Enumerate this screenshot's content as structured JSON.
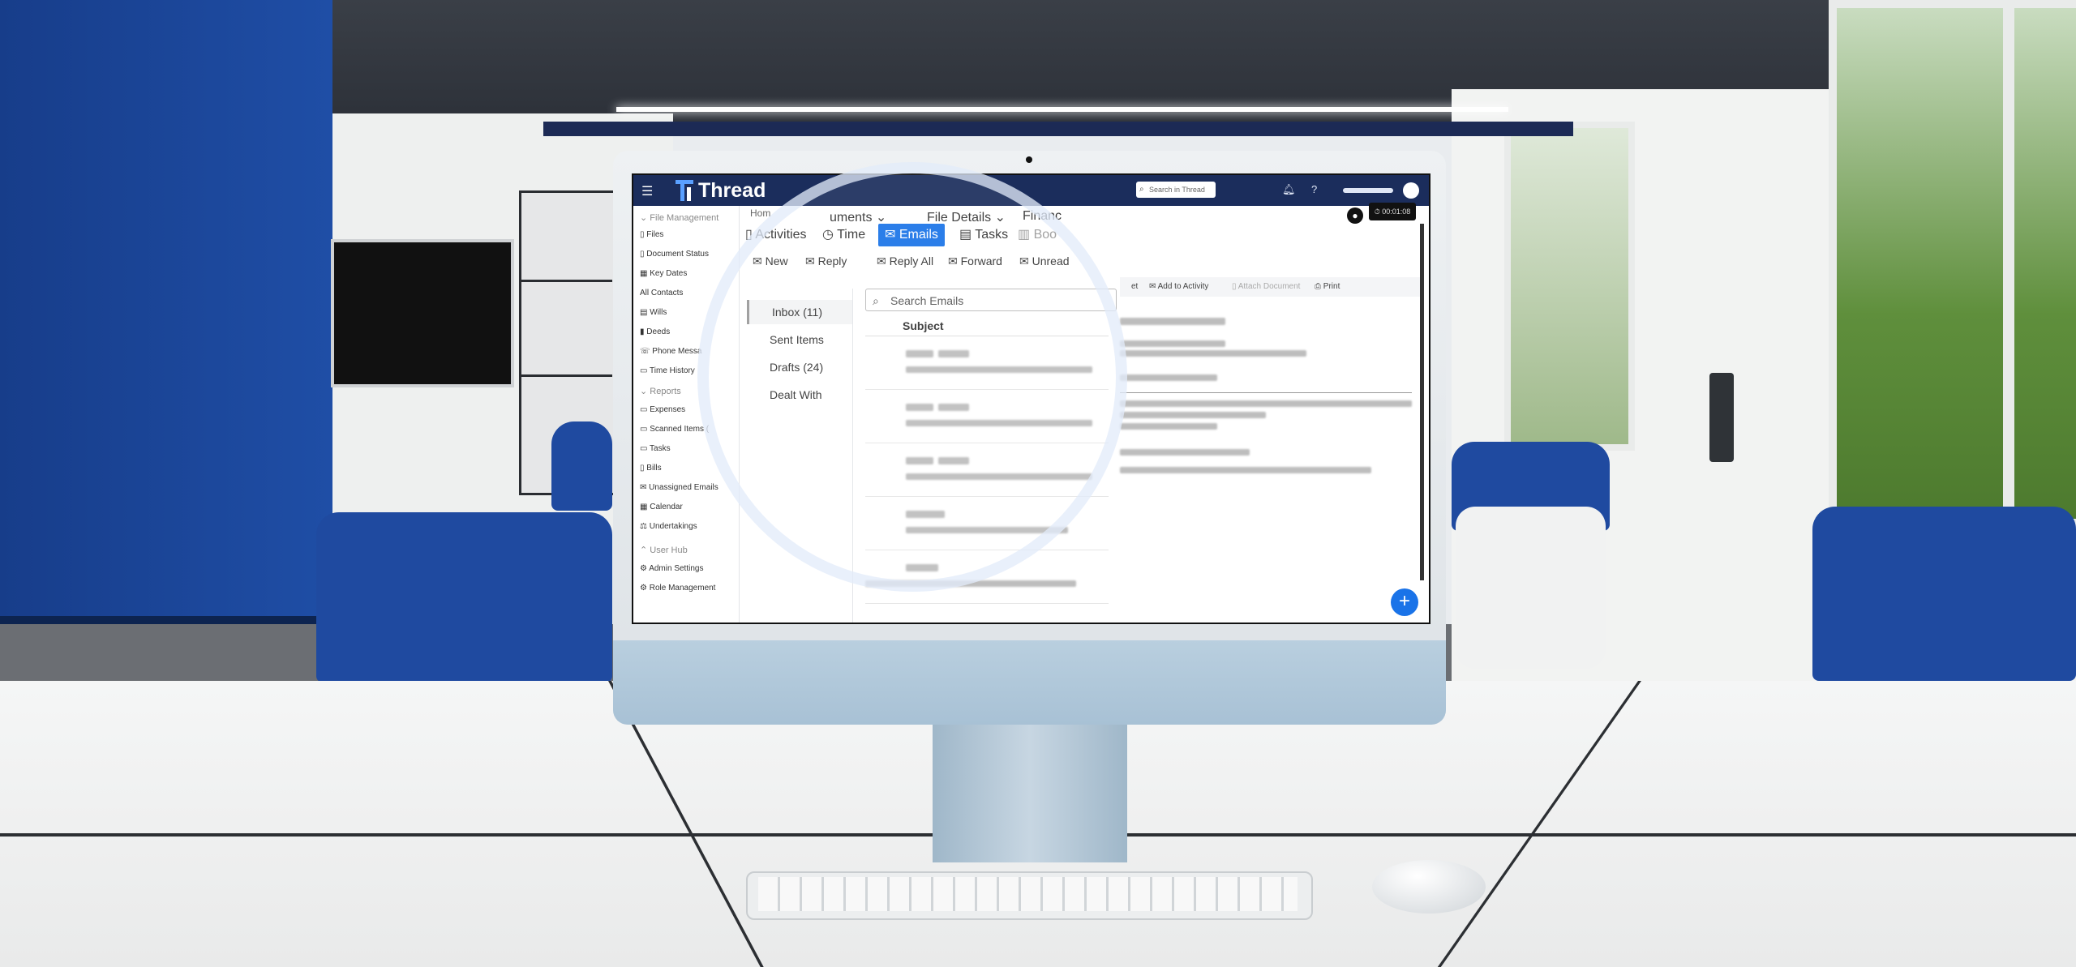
{
  "app": {
    "name": "Thread"
  },
  "topbar": {
    "menu_icon": "hamburger-icon",
    "search_placeholder": "Search in Thread",
    "icons": [
      "bell-icon",
      "help-icon"
    ]
  },
  "sidebar": {
    "sections": [
      {
        "header": "File Management",
        "items": [
          "Files",
          "Document Status",
          "Key Dates",
          "All Contacts",
          "Wills",
          "Deeds",
          "Phone Messa",
          "Time History"
        ]
      },
      {
        "header": "Reports",
        "items": [
          "Expenses",
          "Scanned Items (",
          "Tasks",
          "Bills",
          "Unassigned Emails",
          "Calendar",
          "Undertakings"
        ]
      },
      {
        "header": "User Hub",
        "items": [
          "Admin Settings",
          "Role Management"
        ]
      }
    ]
  },
  "nav": {
    "tabs": [
      "Hom",
      "uments",
      "File Details",
      "Financ"
    ]
  },
  "subtabs": {
    "items": [
      "Activities",
      "Time",
      "Emails",
      "Tasks",
      "Boo"
    ],
    "active": "Emails"
  },
  "toolbar": {
    "buttons": [
      "New",
      "Reply",
      "Reply All",
      "Forward",
      "Unread"
    ]
  },
  "right_toolbar": {
    "items": [
      "et",
      "Add to Activity",
      "Attach Document",
      "Print"
    ]
  },
  "timer": {
    "value": "00:01:08"
  },
  "folders": {
    "items": [
      "Inbox (11)",
      "Sent Items",
      "Drafts (24)",
      "Dealt With"
    ],
    "active": "Inbox (11)"
  },
  "emails": {
    "search_placeholder": "Search Emails",
    "column_header": "Subject"
  },
  "colors": {
    "topbar": "#1b2d5c",
    "accent": "#1a73e8",
    "wall": "#1f4ea6",
    "chair": "#1f4aa0"
  }
}
